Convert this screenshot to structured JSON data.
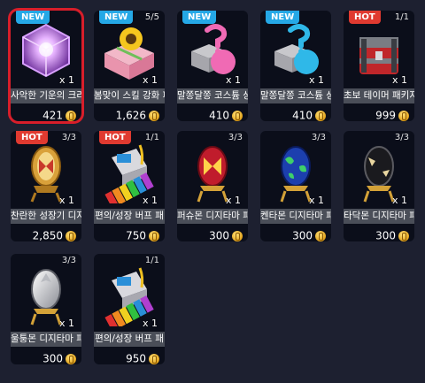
{
  "items": [
    {
      "badge": "NEW",
      "badge_type": "new",
      "stock": "",
      "name": "사악한 기운의 크리",
      "qty": "x 1",
      "price": "421",
      "icon": "purple-crystal-cube-icon",
      "selected": true
    },
    {
      "badge": "NEW",
      "badge_type": "new",
      "stock": "5/5",
      "name": "봄맞이 스킬 강화 패",
      "qty": "x 1",
      "price": "1,626",
      "icon": "sunflower-gift-box-icon",
      "selected": false
    },
    {
      "badge": "NEW",
      "badge_type": "new",
      "stock": "",
      "name": "말쫑달쫑 코스튬 상",
      "qty": "x 1",
      "price": "410",
      "icon": "pink-mystery-box-icon",
      "selected": false
    },
    {
      "badge": "NEW",
      "badge_type": "new",
      "stock": "",
      "name": "말쫑달쫑 코스튬 상",
      "qty": "x 1",
      "price": "410",
      "icon": "blue-mystery-box-icon",
      "selected": false
    },
    {
      "badge": "HOT",
      "badge_type": "hot",
      "stock": "1/1",
      "name": "초보 테이머 패키지",
      "qty": "x 1",
      "price": "999",
      "icon": "red-treasure-chest-icon",
      "selected": false
    },
    {
      "badge": "HOT",
      "badge_type": "hot",
      "stock": "3/3",
      "name": "찬란한 성장기 디지",
      "qty": "x 1",
      "price": "2,850",
      "icon": "golden-digi-egg-icon",
      "selected": false
    },
    {
      "badge": "HOT",
      "badge_type": "hot",
      "stock": "1/1",
      "name": "편의/성장 버프 패",
      "qty": "x 1",
      "price": "750",
      "icon": "buff-package-icon",
      "selected": false
    },
    {
      "badge": "",
      "badge_type": "",
      "stock": "3/3",
      "name": "퍼슈몬 디지타마 패",
      "qty": "x 1",
      "price": "300",
      "icon": "red-digi-egg-icon",
      "selected": false
    },
    {
      "badge": "",
      "badge_type": "",
      "stock": "3/3",
      "name": "켄타몬 디지타마 패",
      "qty": "x 1",
      "price": "300",
      "icon": "blue-digi-egg-icon",
      "selected": false
    },
    {
      "badge": "",
      "badge_type": "",
      "stock": "3/3",
      "name": "타닥몬 디지타마 패",
      "qty": "x 1",
      "price": "300",
      "icon": "black-digi-egg-icon",
      "selected": false
    },
    {
      "badge": "",
      "badge_type": "",
      "stock": "3/3",
      "name": "울퉁몬 디지타마 패",
      "qty": "x 1",
      "price": "300",
      "icon": "silver-digi-egg-icon",
      "selected": false
    },
    {
      "badge": "",
      "badge_type": "",
      "stock": "1/1",
      "name": "편의/성장 버프 패",
      "qty": "x 1",
      "price": "950",
      "icon": "buff-package-icon",
      "selected": false
    }
  ],
  "colors": {
    "new_badge": "#25a8e6",
    "hot_badge": "#e03a30",
    "selection_border": "#d81e2a",
    "background": "#1d2030"
  }
}
